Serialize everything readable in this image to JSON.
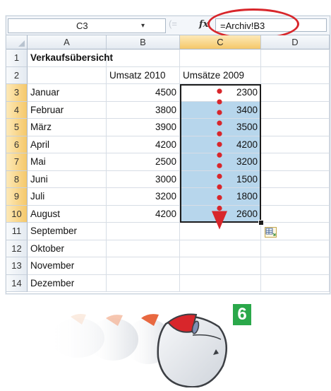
{
  "formula_bar": {
    "name_box": "C3",
    "name_box_dropdown_glyph": "▾",
    "dim_buttons_glyph": "(=",
    "fx_label": "fx",
    "formula": "=Archiv!B3"
  },
  "columns": [
    "A",
    "B",
    "C",
    "D"
  ],
  "active_column": "C",
  "rows": [
    {
      "n": "1",
      "a": "Verkaufsübersicht",
      "b": "",
      "c": "",
      "d": ""
    },
    {
      "n": "2",
      "a": "",
      "b": "Umsatz 2010",
      "c": "Umsätze 2009",
      "d": ""
    },
    {
      "n": "3",
      "a": "Januar",
      "b": "4500",
      "c": "2300",
      "d": ""
    },
    {
      "n": "4",
      "a": "Februar",
      "b": "3800",
      "c": "3400",
      "d": ""
    },
    {
      "n": "5",
      "a": "März",
      "b": "3900",
      "c": "3500",
      "d": ""
    },
    {
      "n": "6",
      "a": "April",
      "b": "4200",
      "c": "4200",
      "d": ""
    },
    {
      "n": "7",
      "a": "Mai",
      "b": "2500",
      "c": "3200",
      "d": ""
    },
    {
      "n": "8",
      "a": "Juni",
      "b": "3000",
      "c": "1500",
      "d": ""
    },
    {
      "n": "9",
      "a": "Juli",
      "b": "3200",
      "c": "1800",
      "d": ""
    },
    {
      "n": "10",
      "a": "August",
      "b": "4200",
      "c": "2600",
      "d": ""
    },
    {
      "n": "11",
      "a": "September",
      "b": "",
      "c": "",
      "d": ""
    },
    {
      "n": "12",
      "a": "Oktober",
      "b": "",
      "c": "",
      "d": ""
    },
    {
      "n": "13",
      "a": "November",
      "b": "",
      "c": "",
      "d": ""
    },
    {
      "n": "14",
      "a": "Dezember",
      "b": "",
      "c": "",
      "d": ""
    }
  ],
  "selection": {
    "from": "C3",
    "to": "C10"
  },
  "step_badge": "6",
  "colors": {
    "callout": "#d8262b",
    "selection_fill": "#b7d6ec",
    "active_header": "#f5c86a",
    "badge": "#2aa84a"
  },
  "icons": [
    "autofill-options-icon",
    "mouse-icon",
    "drag-arrow-icon",
    "fx-icon"
  ]
}
